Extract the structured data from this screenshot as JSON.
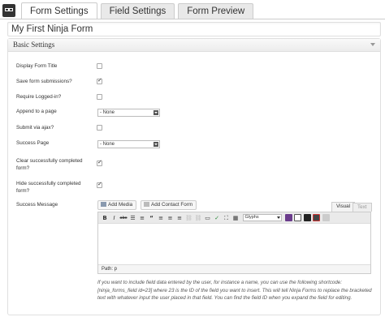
{
  "tabs": [
    {
      "label": "Form Settings",
      "active": true
    },
    {
      "label": "Field Settings",
      "active": false
    },
    {
      "label": "Form Preview",
      "active": false
    }
  ],
  "form_title": "My First Ninja Form",
  "panel": {
    "title": "Basic Settings",
    "settings": {
      "display_title": {
        "label": "Display Form Title",
        "checked": false
      },
      "save_submissions": {
        "label": "Save form submissions?",
        "checked": true
      },
      "require_login": {
        "label": "Require Logged-in?",
        "checked": false
      },
      "append_page": {
        "label": "Append to a page",
        "value": "- None"
      },
      "submit_ajax": {
        "label": "Submit via ajax?",
        "checked": false
      },
      "success_page": {
        "label": "Success Page",
        "value": "- None"
      },
      "clear_completed": {
        "label_line1": "Clear successfully completed",
        "label_line2": "form?",
        "checked": true
      },
      "hide_completed": {
        "label_line1": "Hide successfully completed",
        "label_line2": "form?",
        "checked": true
      },
      "success_message": {
        "label": "Success Message"
      }
    }
  },
  "editor": {
    "add_media": "Add Media",
    "add_contact_form": "Add Contact Form",
    "mode_visual": "Visual",
    "mode_text": "Text",
    "glyphs": "Glyphs",
    "path": "Path: p",
    "icons": [
      "bold-icon",
      "italic-icon",
      "strikethrough-icon",
      "bullet-list-icon",
      "numbered-list-icon",
      "blockquote-icon",
      "align-left-icon",
      "align-center-icon",
      "align-right-icon",
      "link-icon",
      "unlink-icon",
      "more-icon",
      "spellcheck-icon",
      "fullscreen-icon",
      "kitchen-sink-icon"
    ]
  },
  "help_text": {
    "line1": "If you want to include field data entered by the user, for instance a name, you can use the following shortcode:",
    "line2": "[ninja_forms_field id=23] where 23 is the ID of the field you want to insert. This will tell Ninja Forms to replace the bracketed",
    "line3": "text with whatever input the user placed in that field. You can find the field ID when you expand the field for editing."
  },
  "colors": {
    "tab_active_bg": "#ffffff",
    "tab_bg": "#e9e9e9",
    "border": "#cccccc"
  }
}
